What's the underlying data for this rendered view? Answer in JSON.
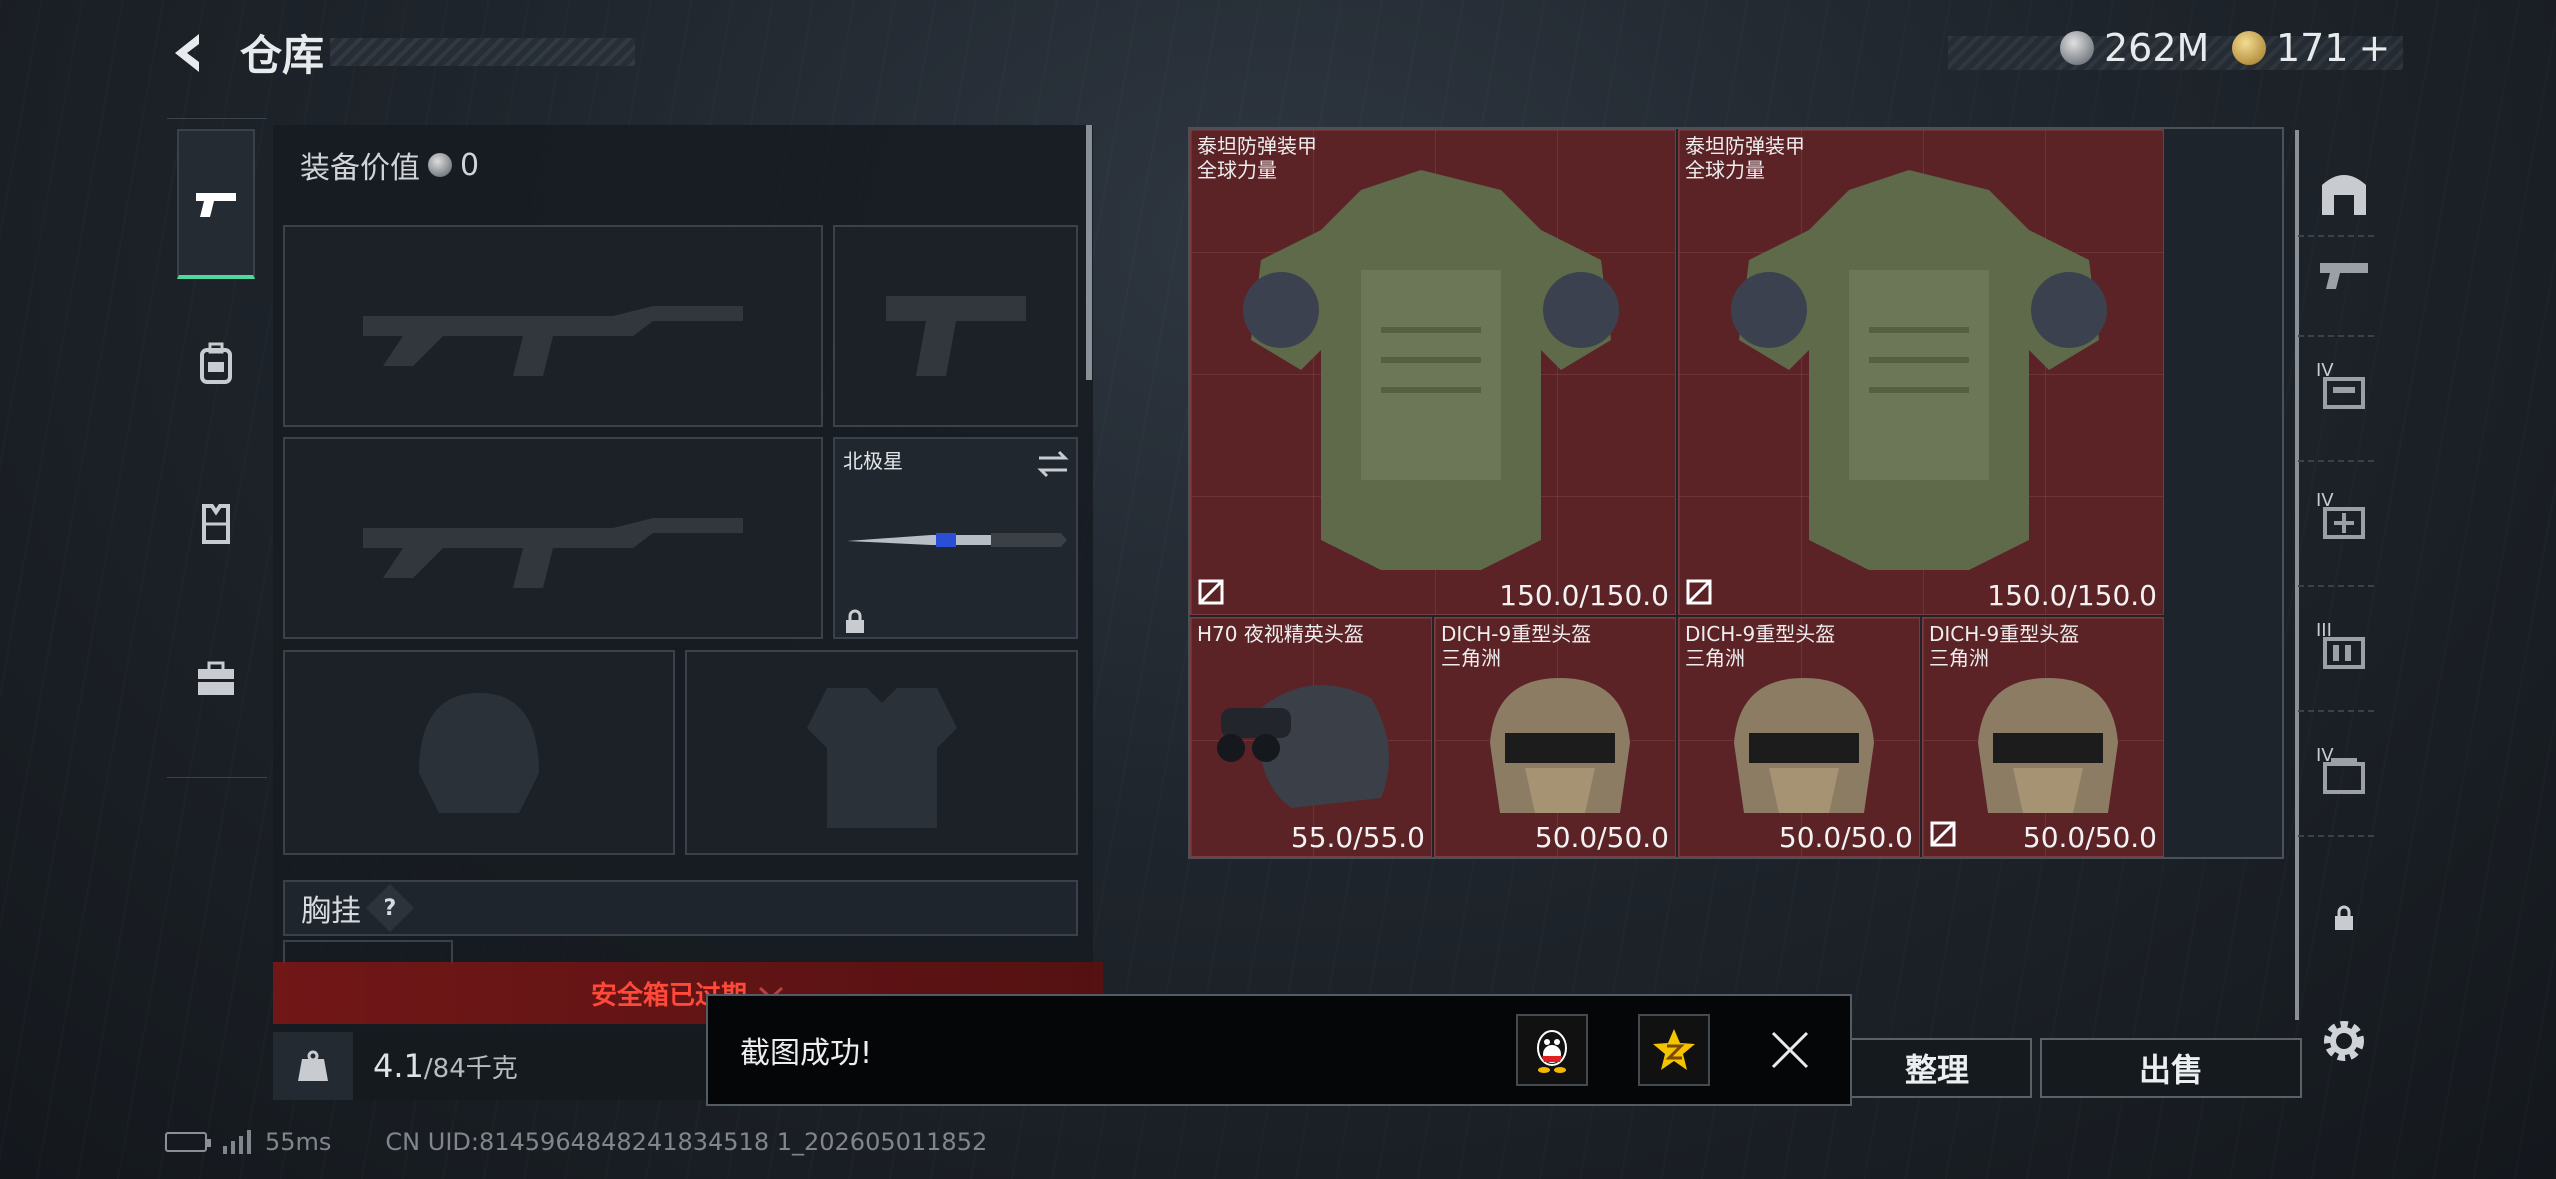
{
  "header": {
    "title": "仓库",
    "currency_silver": "262M",
    "currency_gold": "171",
    "currency_add": "+"
  },
  "loadout": {
    "equip_value_label": "装备价值",
    "equip_value": "0",
    "knife_name": "北极星",
    "chest_label": "胸挂",
    "chest_help": "?",
    "safebox_expired": "安全箱已过期",
    "weight_current": "4.1",
    "weight_max": "/84千克"
  },
  "stash_items": [
    {
      "line1": "泰坦防弹装甲",
      "line2": "全球力量",
      "durability": "150.0/150.0",
      "type": "armor"
    },
    {
      "line1": "泰坦防弹装甲",
      "line2": "全球力量",
      "durability": "150.0/150.0",
      "type": "armor"
    },
    {
      "line1": "H70 夜视精英头盔",
      "line2": "",
      "durability": "55.0/55.0",
      "type": "nvg-helmet"
    },
    {
      "line1": "DICH-9重型头盔",
      "line2": "三角洲",
      "durability": "50.0/50.0",
      "type": "helmet"
    },
    {
      "line1": "DICH-9重型头盔",
      "line2": "三角洲",
      "durability": "50.0/50.0",
      "type": "helmet"
    },
    {
      "line1": "DICH-9重型头盔",
      "line2": "三角洲",
      "durability": "50.0/50.0",
      "type": "helmet"
    }
  ],
  "side_tabs": [
    "weapon-tab",
    "backpack-tab",
    "chest-rig-tab",
    "case-tab"
  ],
  "right_filters": [
    "IV",
    "IV",
    "III",
    "IV"
  ],
  "buttons": {
    "sort": "整理",
    "sell": "出售"
  },
  "toast": {
    "message": "截图成功!"
  },
  "status": {
    "ping": "55ms",
    "uid": "CN UID:8145964848241834518 1_202605011852"
  }
}
